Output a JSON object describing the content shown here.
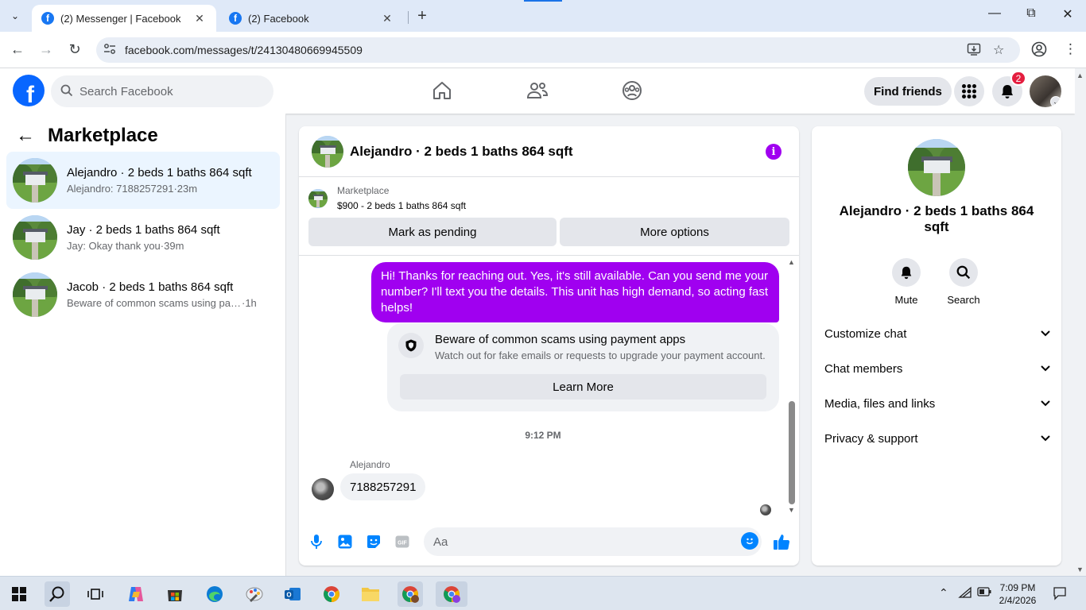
{
  "browser": {
    "tabs": [
      {
        "title": "(2) Messenger | Facebook",
        "active": true
      },
      {
        "title": "(2) Facebook",
        "active": false
      }
    ],
    "url": "facebook.com/messages/t/24130480669945509"
  },
  "header": {
    "search_placeholder": "Search Facebook",
    "find_friends": "Find friends",
    "notification_count": "2"
  },
  "sidebar": {
    "title": "Marketplace",
    "conversations": [
      {
        "name": "Alejandro · 2 beds 1 baths 864 sqft",
        "snippet": "Alejandro: 7188257291",
        "time": "·23m",
        "selected": true
      },
      {
        "name": "Jay · 2 beds 1 baths 864 sqft",
        "snippet": "Jay: Okay thank you",
        "time": "·39m",
        "selected": false
      },
      {
        "name": "Jacob · 2 beds 1 baths 864 sqft",
        "snippet": "Beware of common scams using pay...",
        "time": " ·1h",
        "selected": false
      }
    ]
  },
  "chat": {
    "title": "Alejandro · 2 beds 1 baths 864 sqft",
    "marketplace_label": "Marketplace",
    "listing": "$900 - 2 beds 1 baths 864 sqft",
    "mark_pending": "Mark as pending",
    "more_options": "More options",
    "outgoing_message": "Hi! Thanks for reaching out. Yes, it's still available. Can you send me your number? I'll text you the details. This unit has high demand, so acting fast helps!",
    "scam_title": "Beware of common scams using payment apps",
    "scam_desc": "Watch out for fake emails or requests to upgrade your payment account.",
    "learn_more": "Learn More",
    "timestamp": "9:12 PM",
    "sender": "Alejandro",
    "incoming_message": "7188257291",
    "input_placeholder": "Aa"
  },
  "info_panel": {
    "name": "Alejandro · 2 beds 1 baths 864 sqft",
    "mute": "Mute",
    "search": "Search",
    "sections": [
      "Customize chat",
      "Chat members",
      "Media, files and links",
      "Privacy & support"
    ]
  },
  "taskbar": {
    "time": "7:09 PM",
    "date": "2/4/2026"
  },
  "colors": {
    "fb_blue": "#0866ff",
    "messenger_purple": "#a000f0",
    "selected_bg": "#ebf5ff",
    "badge_red": "#e41e3f"
  }
}
